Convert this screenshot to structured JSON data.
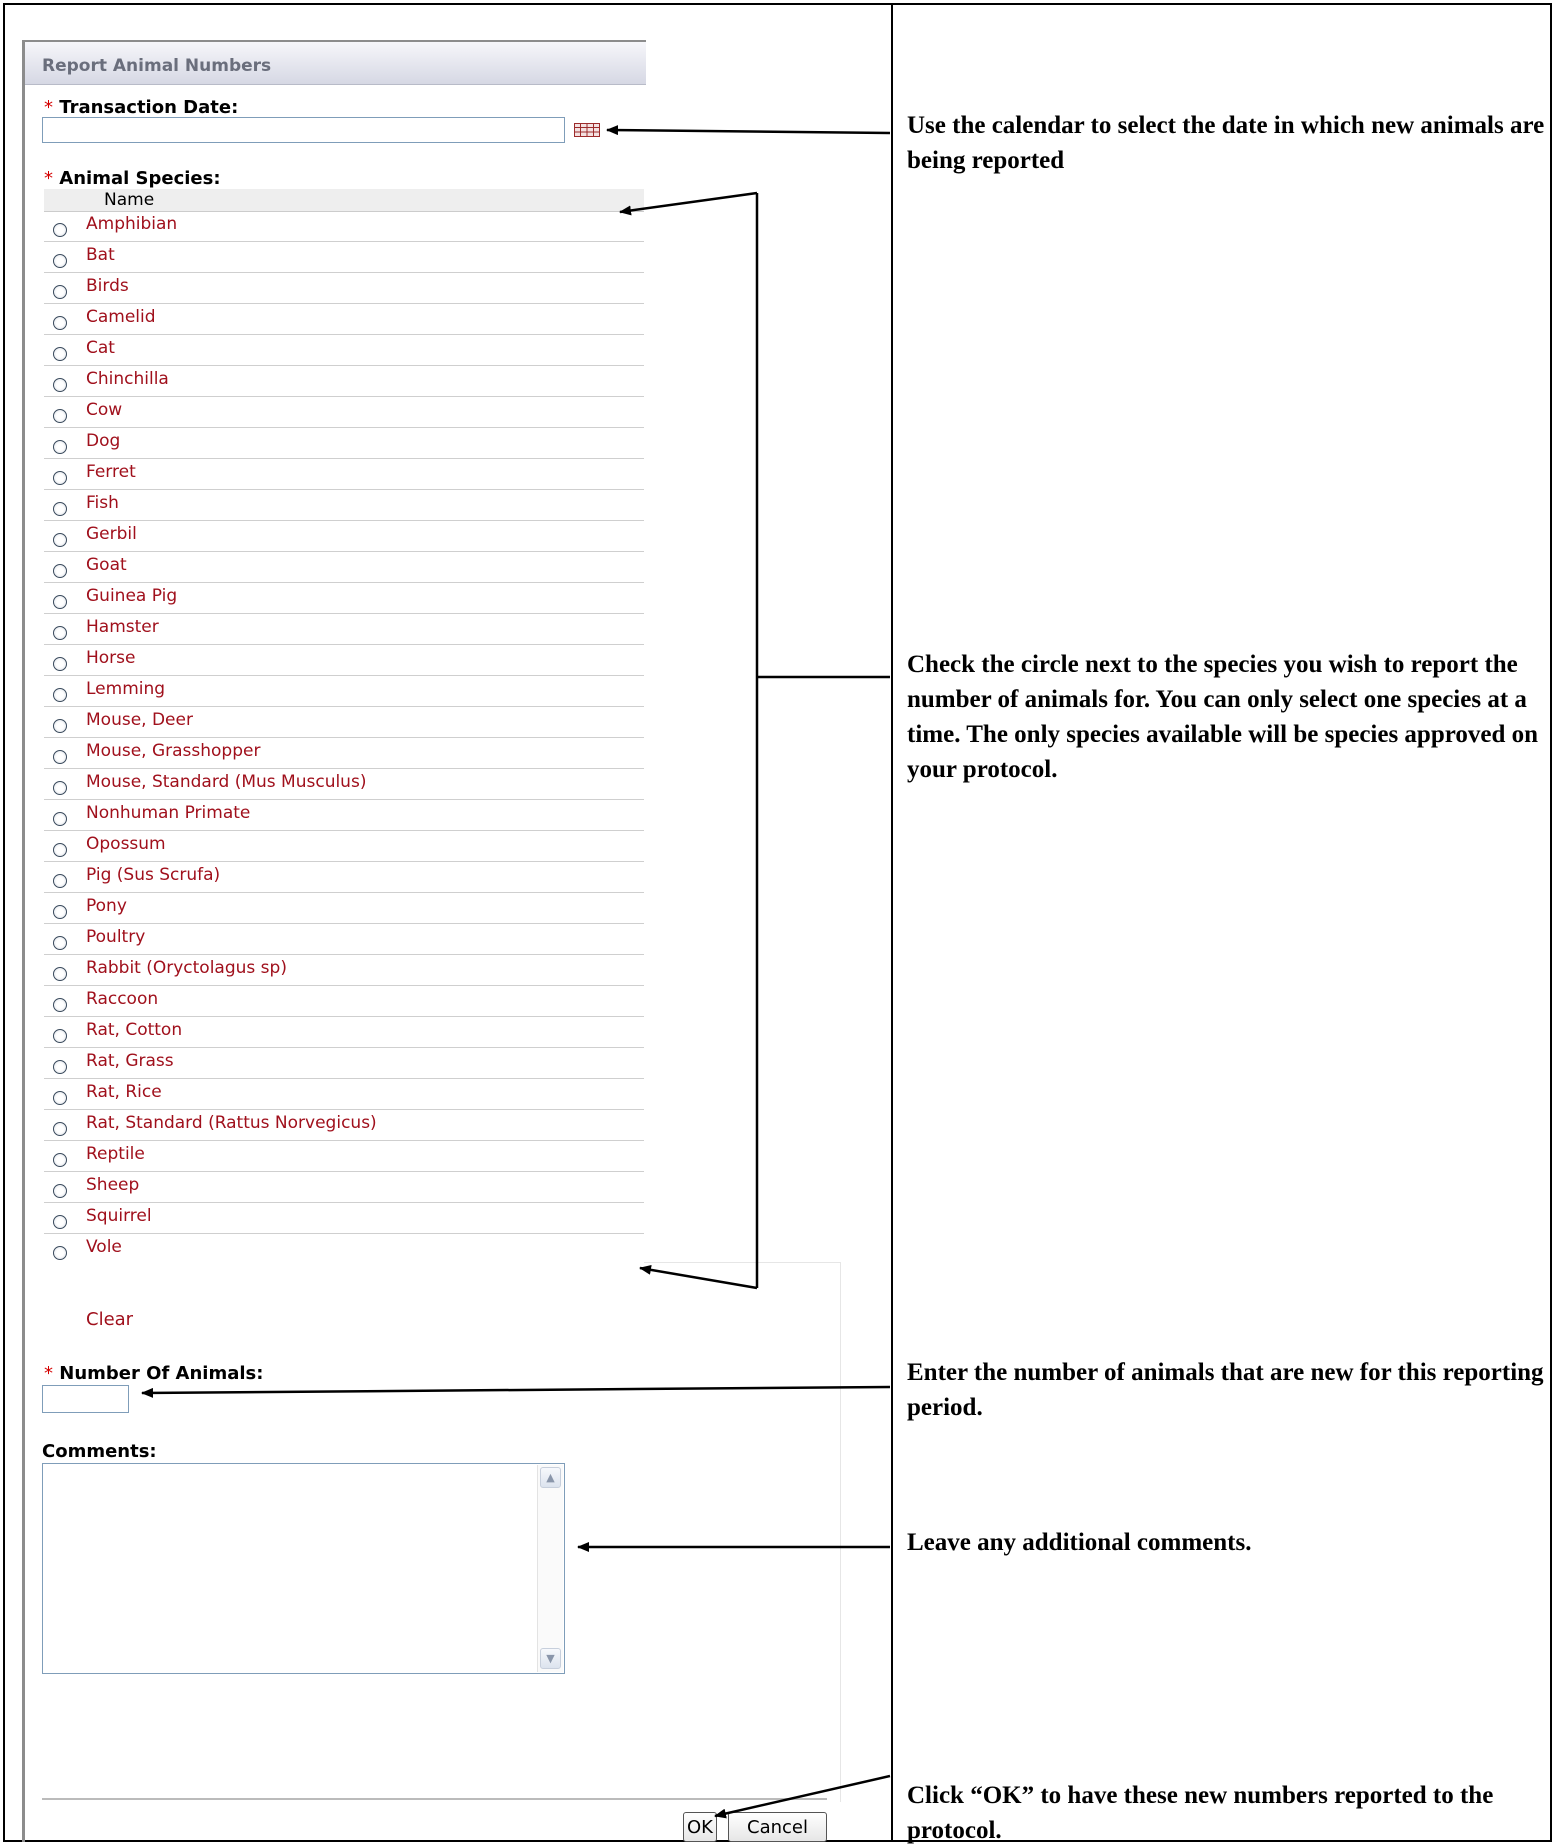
{
  "form": {
    "title": "Report Animal Numbers",
    "required_marker": "*",
    "transaction_date_label": "Transaction Date:",
    "transaction_date_value": "",
    "animal_species_label": "Animal Species:",
    "species_column_header": "Name",
    "species": [
      "Amphibian",
      "Bat",
      "Birds",
      "Camelid",
      "Cat",
      "Chinchilla",
      "Cow",
      "Dog",
      "Ferret",
      "Fish",
      "Gerbil",
      "Goat",
      "Guinea Pig",
      "Hamster",
      "Horse",
      "Lemming",
      "Mouse, Deer",
      "Mouse, Grasshopper",
      "Mouse, Standard (Mus Musculus)",
      "Nonhuman Primate",
      "Opossum",
      "Pig (Sus Scrufa)",
      "Pony",
      "Poultry",
      "Rabbit (Oryctolagus sp)",
      "Raccoon",
      "Rat, Cotton",
      "Rat, Grass",
      "Rat, Rice",
      "Rat, Standard (Rattus Norvegicus)",
      "Reptile",
      "Sheep",
      "Squirrel",
      "Vole"
    ],
    "clear_link": "Clear",
    "number_of_animals_label": "Number Of Animals:",
    "number_of_animals_value": "",
    "comments_label": "Comments:",
    "comments_value": "",
    "ok_button": "OK",
    "cancel_button": "Cancel"
  },
  "annotations": {
    "calendar_note": "Use the calendar to select the date in which new animals are being reported",
    "species_note": "Check the circle next to the species you wish to report the number of animals for.  You can only select one species at a time.  The only species available will be species approved on your protocol.",
    "number_note": "Enter the number of animals that are new for this reporting period.",
    "comments_note": "Leave any additional comments.",
    "ok_note": "Click “OK” to have these new numbers reported to the protocol."
  },
  "icons": {
    "calendar": "calendar-icon",
    "scroll_up": "scroll-up-arrow-icon",
    "scroll_down": "scroll-down-arrow-icon"
  },
  "colors": {
    "species_link": "#a0101c",
    "required_marker": "#d40000",
    "header_title": "#6a6e7c",
    "input_border": "#7f9db9"
  }
}
